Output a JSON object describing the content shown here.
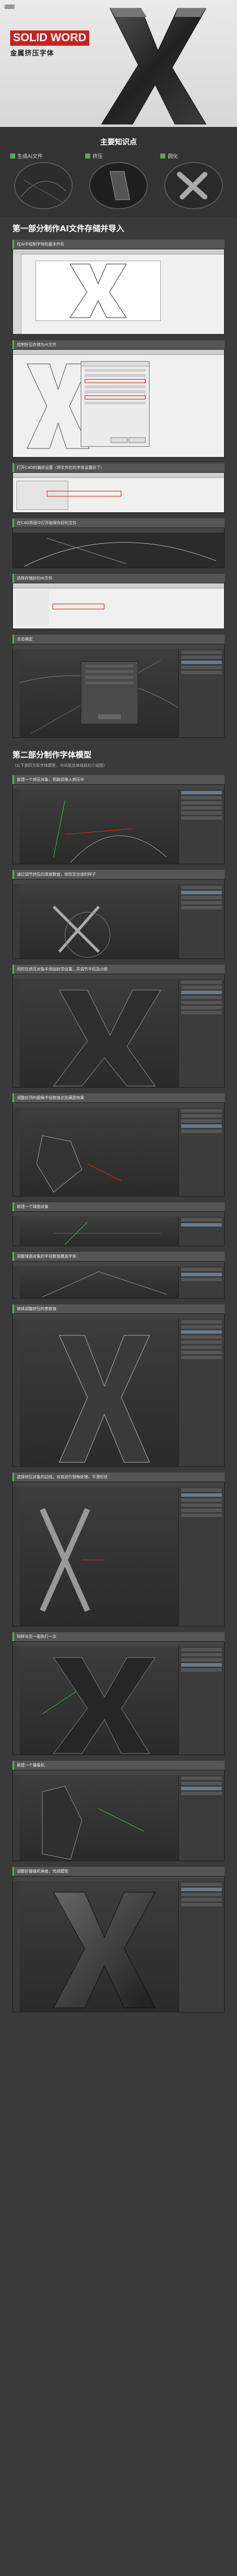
{
  "header": {
    "brand_left": "",
    "title_en": "SOLID WORD",
    "title_cn": "金属挤压字体",
    "subtitle": ""
  },
  "knowledge": {
    "heading": "主要知识点",
    "items": [
      {
        "label": "生成AI文件"
      },
      {
        "label": "挤压"
      },
      {
        "label": "圆化"
      }
    ]
  },
  "part1": {
    "title": "第一部分制作AI文件存储并导入",
    "steps": [
      {
        "caption": "在AI中绘制字体的基本外形"
      },
      {
        "caption": "绘制好后存储为AI文件"
      },
      {
        "caption": "打开C4D的偏好设置（将文件栏的字体设置好了）"
      },
      {
        "caption": "在C4D界面中打开刚保存好的文件"
      },
      {
        "caption": "选择存储好的AI文件"
      },
      {
        "caption": "点击确定"
      }
    ]
  },
  "part2": {
    "title": "第二部分制作字体模型",
    "subtitle": "（以下是四方形字体模型，中间是总体线段的介绍图）",
    "steps": [
      {
        "caption": "新建一个挤压对象，把路径拖入挤压中"
      },
      {
        "caption": "通过调节挤压的厚度数值，修改至合适的样子"
      },
      {
        "caption": "同时在挤压对象中添加封顶设置，并调节半径及分段"
      },
      {
        "caption": "调整封顶的圆角半径数值达到满意效果"
      },
      {
        "caption": "新建一个球面对象"
      },
      {
        "caption": "调整球面对象的半径数值覆盖字体"
      },
      {
        "caption": "继续调整挤压的参数值"
      },
      {
        "caption": "选择挤压对象的边线，对其进行倒角处理，平滑形状"
      },
      {
        "caption": "同样对另一面执行一次"
      },
      {
        "caption": "新建一个摄像机"
      },
      {
        "caption": "调整好摄像机角度，完成模型"
      }
    ]
  },
  "colors": {
    "accent_red": "#ca2020",
    "accent_green": "#4caf50",
    "bg_dark": "#3a3a3a"
  }
}
